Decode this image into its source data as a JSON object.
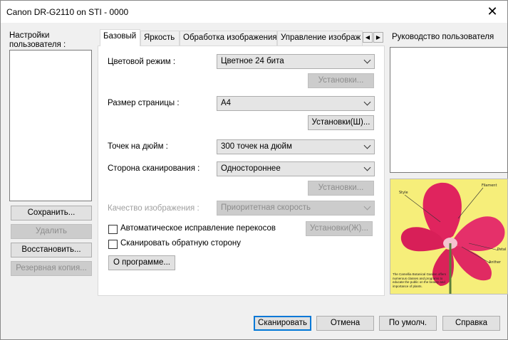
{
  "window": {
    "title": "Canon DR-G2110 on STI - 0000",
    "close_glyph": "✕"
  },
  "user_settings": {
    "label": "Настройки пользователя :",
    "buttons": {
      "save": "Сохранить...",
      "delete": "Удалить",
      "restore": "Восстановить...",
      "backup": "Резервная копия..."
    }
  },
  "tabs": [
    "Базовый",
    "Яркость",
    "Обработка изображения",
    "Управление изображ"
  ],
  "tab_scroll": {
    "left": "◀",
    "right": "▶"
  },
  "basic": {
    "color_mode": {
      "label": "Цветовой режим :",
      "value": "Цветное 24 бита",
      "settings_button": "Установки..."
    },
    "page_size": {
      "label": "Размер страницы :",
      "value": "A4",
      "settings_button": "Установки(Ш)..."
    },
    "dpi": {
      "label": "Точек на дюйм :",
      "value": "300 точек на дюйм"
    },
    "scan_side": {
      "label": "Сторона сканирования :",
      "value": "Одностороннее",
      "settings_button": "Установки..."
    },
    "image_quality": {
      "label": "Качество изображения :",
      "value": "Приоритетная скорость"
    },
    "deskew": {
      "label": "Автоматическое исправление перекосов",
      "checked": false,
      "settings_button": "Установки(Ж)..."
    },
    "scan_back": {
      "label": "Сканировать обратную сторону",
      "checked": false
    },
    "about_button": "О программе..."
  },
  "user_manual": {
    "label": "Руководство пользователя"
  },
  "preview_image": {
    "labels": [
      "Style",
      "Filament",
      "Petal",
      "Anther"
    ],
    "caption": "The Camellia Botanical Garden offers numerous classes and programs to educate the public on the beauty and importance of plants."
  },
  "footer": {
    "scan": "Сканировать",
    "cancel": "Отмена",
    "defaults": "По умолч.",
    "help": "Справка"
  },
  "colors": {
    "accent": "#0078d7",
    "petal": "#e0245e",
    "preview_bg": "#f6ee7a"
  }
}
